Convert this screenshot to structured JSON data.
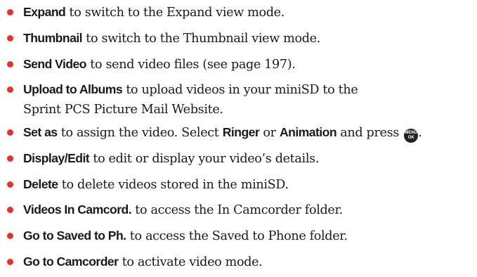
{
  "items": [
    {
      "term": "Expand",
      "desc": " to switch to the Expand view mode."
    },
    {
      "term": "Thumbnail",
      "desc": " to switch to the Thumbnail view mode."
    },
    {
      "term": "Send Video",
      "desc": " to send video files (see page 197)."
    },
    {
      "term": "Upload to Albums",
      "desc": " to upload videos in your miniSD to the",
      "desc2": "Sprint PCS Picture Mail Website."
    },
    {
      "term": "Set as",
      "desc": " to assign the video. Select ",
      "term2": "Ringer",
      "mid": " or ",
      "term3": "Animation",
      "tail": " and press ",
      "key_top": "MENU",
      "key_bottom": "OK",
      "end": "."
    },
    {
      "term": "Display/Edit",
      "desc": " to edit or display your video’s details."
    },
    {
      "term": "Delete",
      "desc": " to delete videos stored in the miniSD."
    },
    {
      "term": "Videos In Camcord.",
      "desc": " to access the In Camcorder folder."
    },
    {
      "term": "Go to Saved to Ph.",
      "desc": " to access the Saved to Phone folder."
    },
    {
      "term": "Go to Camcorder",
      "desc": " to activate video mode."
    }
  ],
  "colors": {
    "bullet": "#e8312b",
    "text": "#1a1a1a"
  }
}
